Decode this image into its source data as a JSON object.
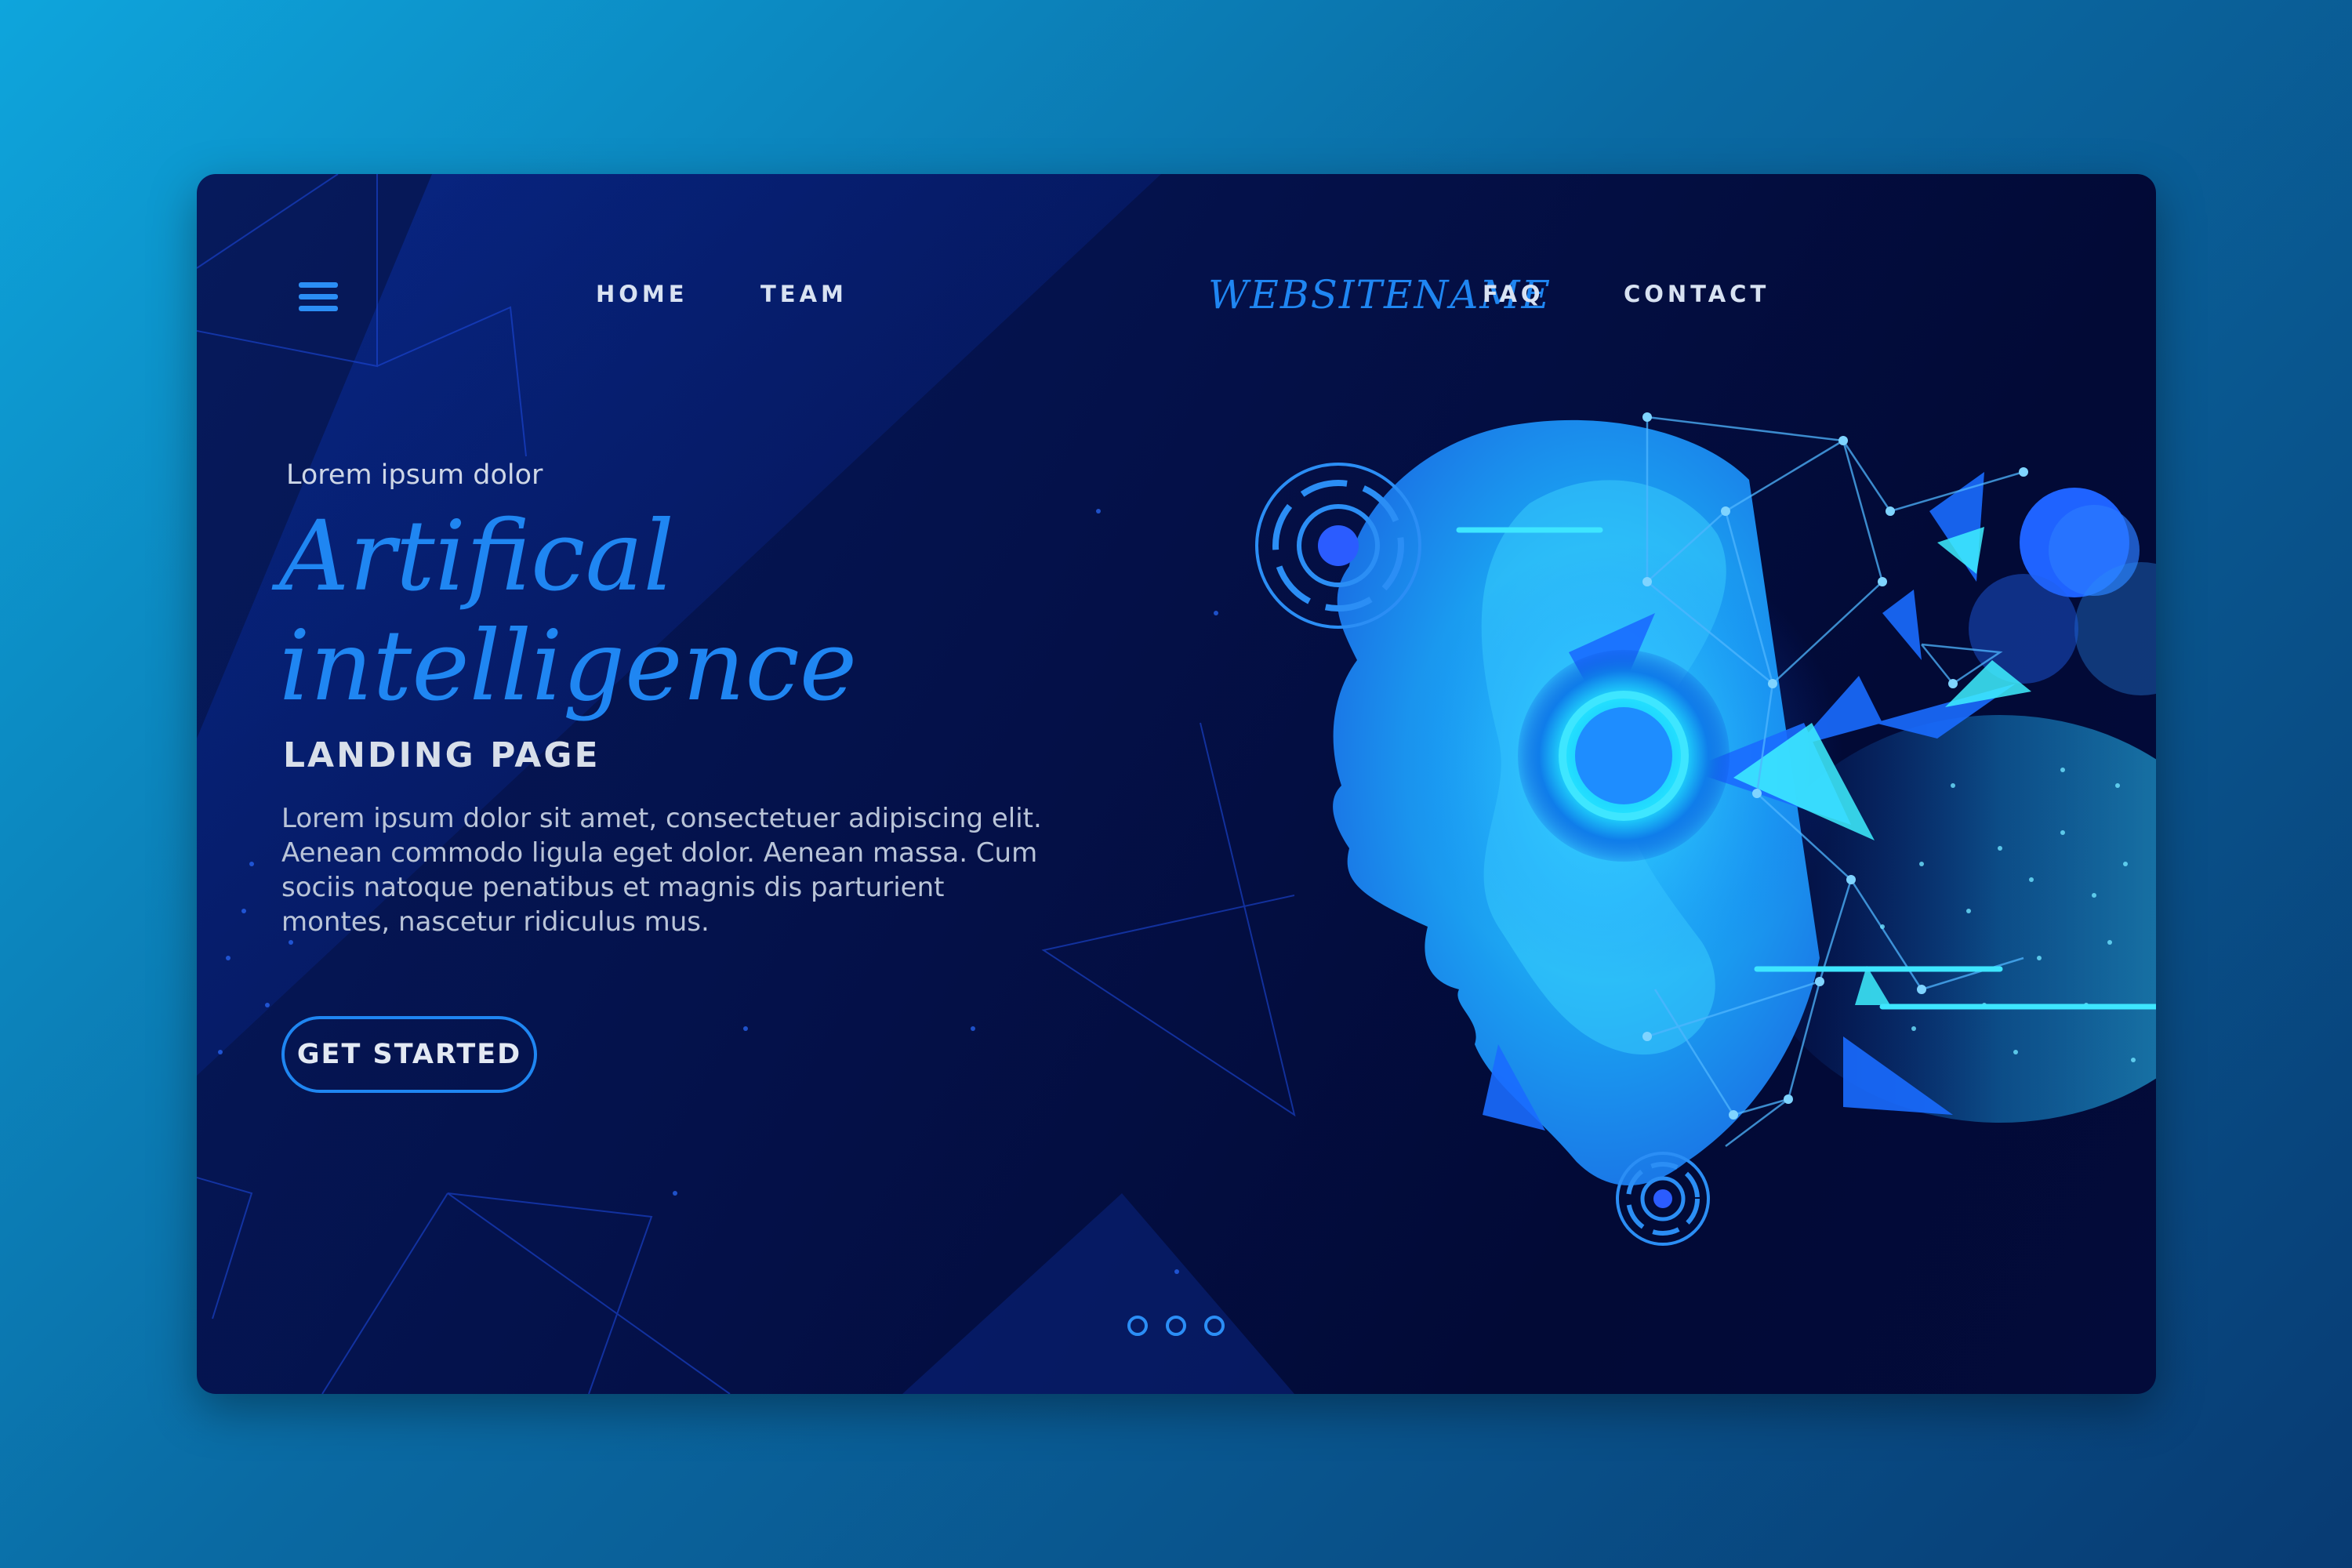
{
  "nav": {
    "menu_icon": "hamburger-menu-icon",
    "items_left": [
      "HOME",
      "TEAM"
    ],
    "brand": "WEBSITENAME",
    "items_right": [
      "FAQ",
      "CONTACT"
    ]
  },
  "hero": {
    "eyebrow": "Lorem ipsum dolor",
    "title_line1": "Artifical",
    "title_line2": "intelligence",
    "subtitle": "LANDING PAGE",
    "body": "Lorem ipsum dolor sit amet, consectetuer adipiscing elit. Aenean commodo ligula eget dolor. Aenean massa. Cum sociis natoque penatibus et magnis dis parturient montes, nascetur ridiculus mus.",
    "cta_label": "GET STARTED"
  },
  "carousel": {
    "slides": 3
  },
  "colors": {
    "accent": "#1f86f2",
    "card_bg": "#04114a",
    "page_bg_start": "#0ea5dc",
    "page_bg_end": "#083b73",
    "head_glow": "#12c8f0"
  }
}
